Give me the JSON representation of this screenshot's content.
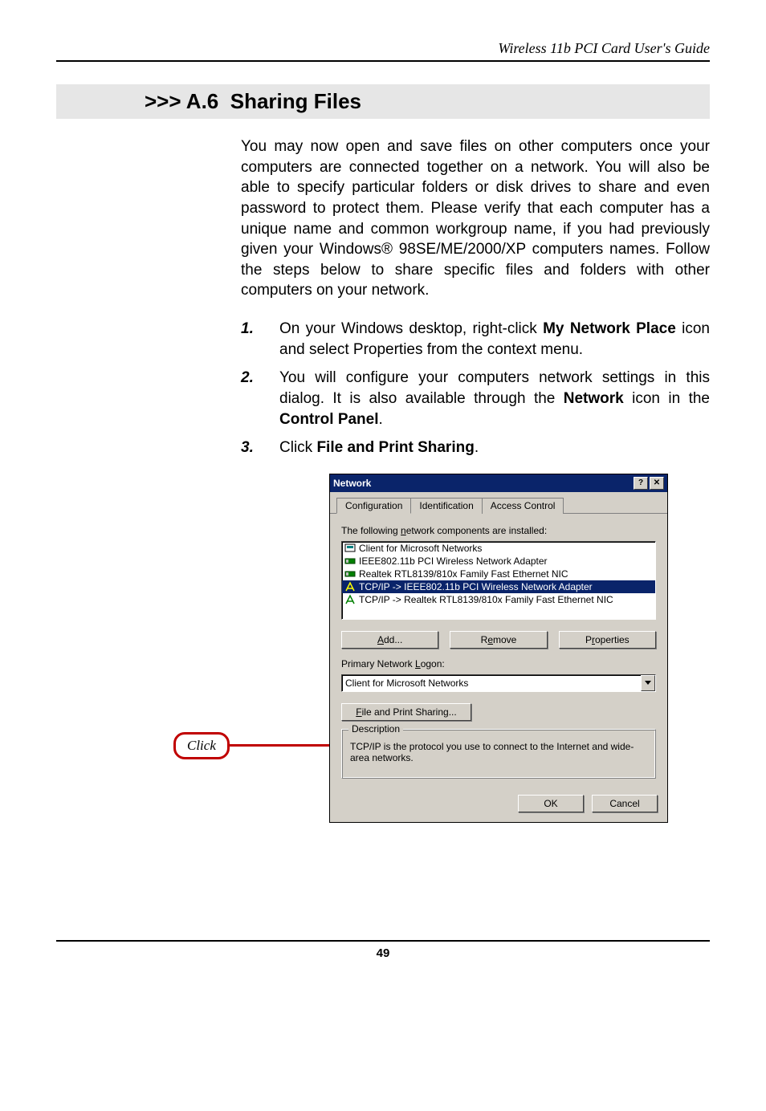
{
  "header": {
    "title": "Wireless 11b PCI Card User's Guide"
  },
  "section": {
    "prefix": ">>> A.6",
    "title": "Sharing Files"
  },
  "body": "You may now open and save files on other computers once your computers are connected together on a network.  You will also be able to specify particular folders or disk drives to share and even password to protect them.  Please verify that each computer has a unique name and common workgroup name, if you had previously given your Windows® 98SE/ME/2000/XP computers names.  Follow the steps below to share specific files and folders with other computers on your network.",
  "steps": [
    {
      "num": "1.",
      "pre": "On your Windows desktop, right-click ",
      "b1": "My Network Place",
      "post": " icon and select Properties from the context menu."
    },
    {
      "num": "2.",
      "pre": "You will configure your computers network settings in this dialog.  It is also available through the ",
      "b1": "Network",
      "mid": " icon in the ",
      "b2": "Control Panel",
      "post": "."
    },
    {
      "num": "3.",
      "pre": "Click ",
      "b1": "File and Print Sharing",
      "post": "."
    }
  ],
  "callout": {
    "label": "Click"
  },
  "dialog": {
    "title": "Network",
    "tabs": [
      "Configuration",
      "Identification",
      "Access Control"
    ],
    "components_label": "The following network components are installed:",
    "components": [
      "Client for Microsoft Networks",
      "IEEE802.11b PCI Wireless Network Adapter",
      "Realtek RTL8139/810x Family Fast Ethernet NIC",
      "TCP/IP -> IEEE802.11b PCI Wireless Network Adapter",
      "TCP/IP -> Realtek RTL8139/810x Family Fast Ethernet NIC"
    ],
    "selected_index": 3,
    "buttons": {
      "add": "Add...",
      "remove": "Remove",
      "properties": "Properties"
    },
    "logon_label": "Primary Network Logon:",
    "logon_value": "Client for Microsoft Networks",
    "file_print_sharing": "File and Print Sharing...",
    "description_legend": "Description",
    "description_text": "TCP/IP is the protocol you use to connect to the Internet and wide-area networks.",
    "ok": "OK",
    "cancel": "Cancel"
  },
  "footer": {
    "page": "49"
  }
}
